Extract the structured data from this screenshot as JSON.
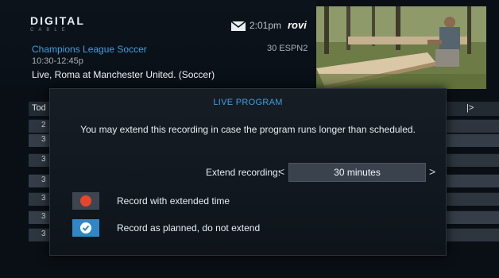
{
  "header": {
    "logo": "DIGITAL",
    "logo_sub": "CABLE",
    "time": "2:01pm",
    "brand": "rovi"
  },
  "program": {
    "title": "Champions League Soccer",
    "time": "10:30-12:45p",
    "channel": "30 ESPN2",
    "description": "Live, Roma at Manchester United. (Soccer)"
  },
  "guide": {
    "header_left": "Tod",
    "header_right": "|>",
    "rows": [
      "2",
      "3",
      "3",
      "3",
      "3",
      "3",
      "3"
    ]
  },
  "dialog": {
    "title": "LIVE PROGRAM",
    "message": "You may extend this recording in case the program runs longer than scheduled.",
    "extend_label": "Extend recording:",
    "extend_value": "30 minutes",
    "arrow_left": "<",
    "arrow_right": ">",
    "options": [
      {
        "label": "Record with extended time",
        "icon": "record-dot-icon",
        "color": "#e8452d"
      },
      {
        "label": "Record as planned, do not extend",
        "icon": "check-circle-icon",
        "color": "#2f87c7"
      }
    ]
  }
}
